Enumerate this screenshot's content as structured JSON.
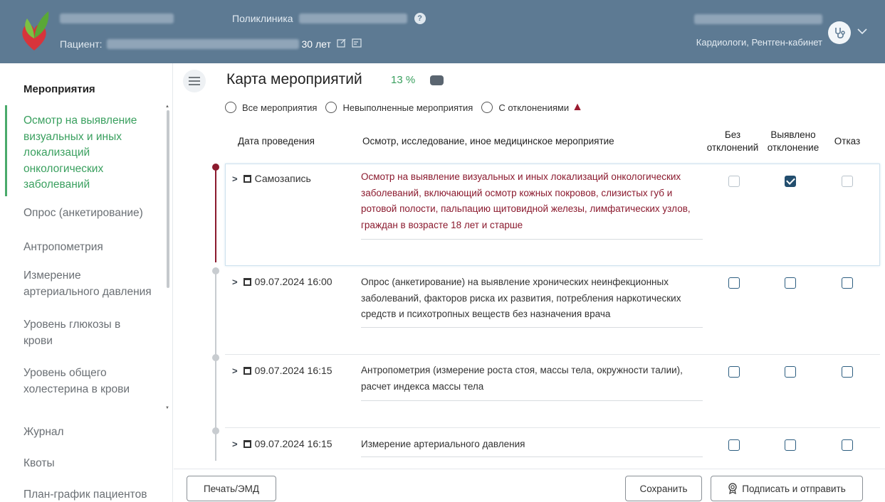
{
  "header": {
    "clinic_label": "Поликлиника",
    "patient_label": "Пациент:",
    "patient_age": "30 лет",
    "department": "Кардиологи, Рентген-кабинет",
    "help_symbol": "?"
  },
  "sidebar": {
    "title": "Мероприятия",
    "active_item": "Осмотр на выявление визуальных и иных локализаций онкологических заболеваний",
    "items": [
      "Опрос (анкетирование)",
      "Антропометрия",
      "Измерение артериального давления",
      "Уровень глюкозы в крови",
      "Уровень общего холестерина в крови"
    ],
    "links": [
      "Журнал",
      "Квоты",
      "План-график пациентов"
    ]
  },
  "main": {
    "title": "Карта мероприятий",
    "percent": "13 %",
    "filters": [
      "Все мероприятия",
      "Невыполненные мероприятия",
      "С отклонениями"
    ],
    "columns": {
      "date": "Дата проведения",
      "event": "Осмотр, исследование, иное медицинское мероприятие",
      "no_deviation": "Без отклонений",
      "deviation": "Выявлено отклонение",
      "refusal": "Отказ"
    },
    "rows": [
      {
        "date": "Самозапись",
        "text": "Осмотр на выявление визуальных и иных локализаций онкологических заболеваний, включающий осмотр кожных покровов, слизистых губ и ротовой полости, пальпацию щитовидной железы, лимфатических узлов, граждан в возрасте 18 лет и старше",
        "no_deviation": false,
        "deviation": true,
        "refusal": false
      },
      {
        "date": "09.07.2024 16:00",
        "text": "Опрос (анкетирование) на выявление хронических неинфекционных заболеваний, факторов риска их развития, потребления наркотических средств и психотропных веществ без назначения врача",
        "no_deviation": false,
        "deviation": false,
        "refusal": false
      },
      {
        "date": "09.07.2024 16:15",
        "text": "Антропометрия (измерение роста стоя, массы тела, окружности талии), расчет индекса массы тела",
        "no_deviation": false,
        "deviation": false,
        "refusal": false
      },
      {
        "date": "09.07.2024 16:15",
        "text": "Измерение артериального давления",
        "no_deviation": false,
        "deviation": false,
        "refusal": false
      }
    ]
  },
  "footer": {
    "print_label": "Печать/ЭМД",
    "save_label": "Сохранить",
    "sign_label": "Подписать и отправить"
  },
  "colors": {
    "header_bg": "#5d7a93",
    "accent_green": "#3aa05f",
    "accent_maroon": "#8b1a2e",
    "checkbox_checked": "#234e6e"
  }
}
